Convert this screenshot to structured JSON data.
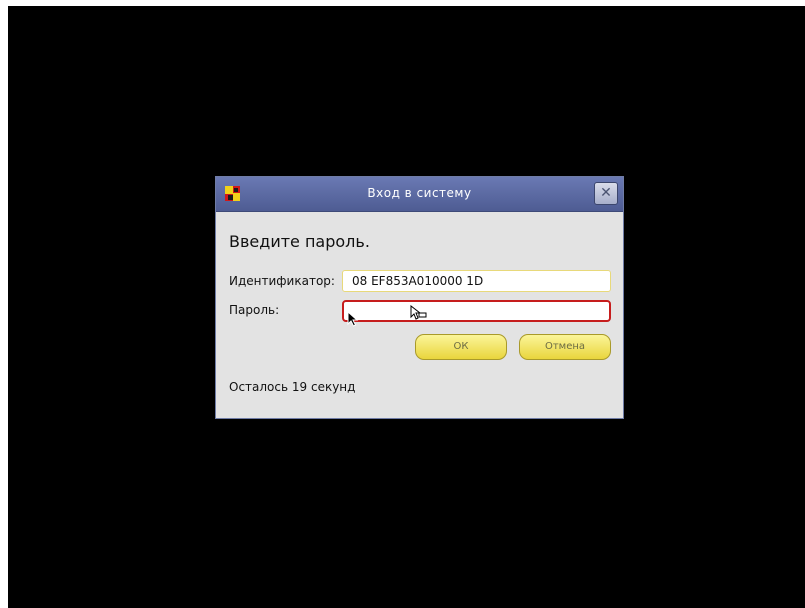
{
  "dialog": {
    "title": "Вход в систему",
    "app_icon": "app-logo-icon",
    "close_glyph": "✕",
    "heading": "Введите пароль.",
    "id_label": "Идентификатор:",
    "id_value": "08 EF853A010000 1D",
    "password_label": "Пароль:",
    "password_value": "",
    "ok_label": "ОК",
    "cancel_label": "Отмена",
    "status": "Осталось 19 секунд"
  },
  "colors": {
    "screen_bg": "#000000",
    "titlebar": "#5b69a3",
    "dialog_bg": "#e3e3e3",
    "button_yellow": "#f3e56a",
    "focus_red": "#c61d1d"
  }
}
